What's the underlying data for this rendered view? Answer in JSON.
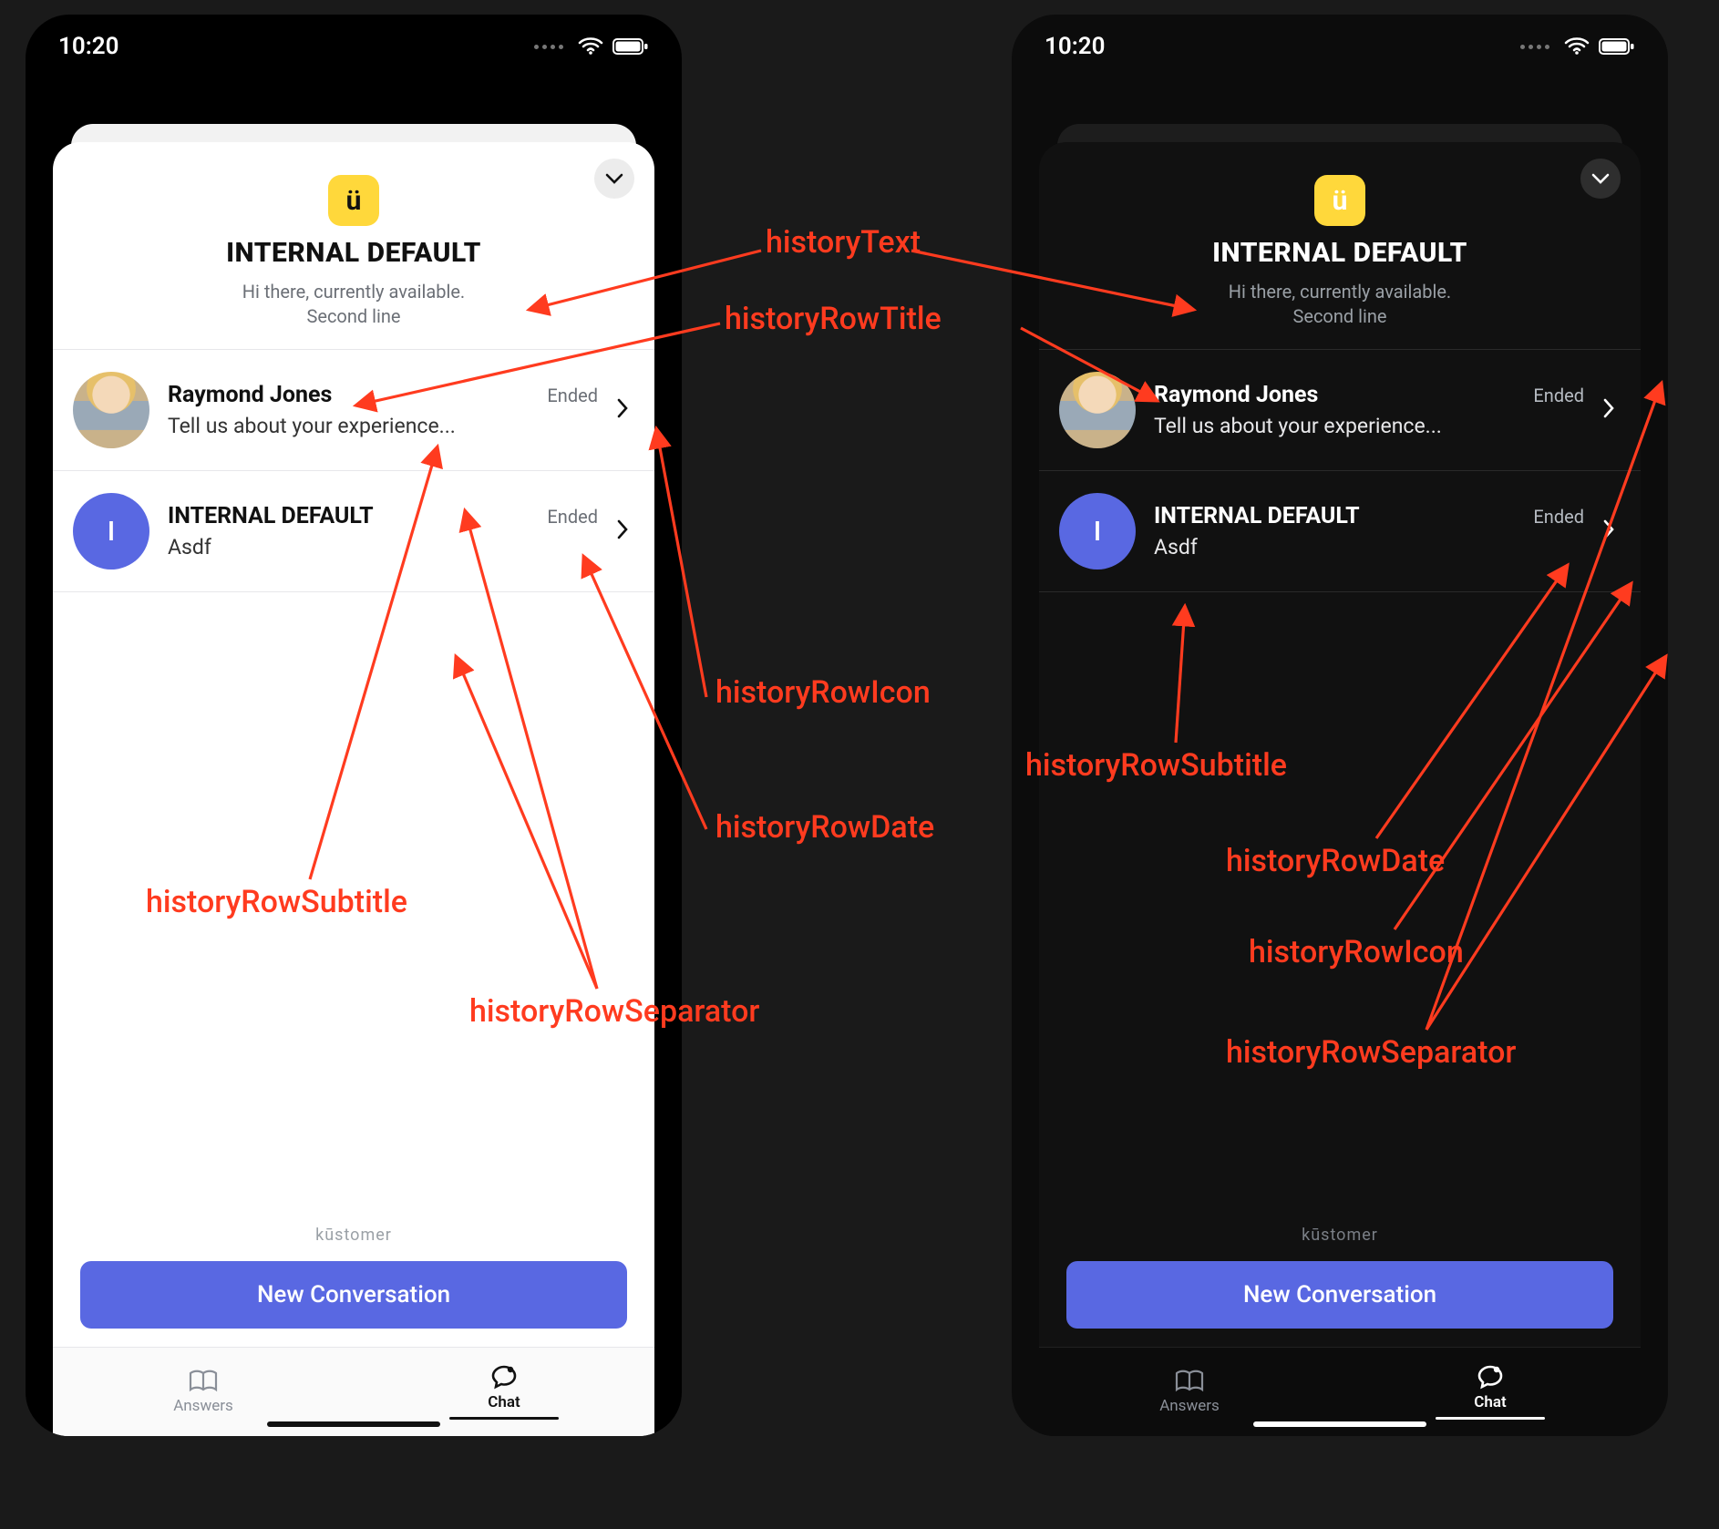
{
  "status": {
    "time": "10:20"
  },
  "header": {
    "title": "INTERNAL DEFAULT",
    "subtitle_line1": "Hi there, currently available.",
    "subtitle_line2": "Second line",
    "logo_glyph": "ü"
  },
  "rows": [
    {
      "avatar_kind": "photo",
      "avatar_initial": "",
      "title": "Raymond Jones",
      "subtitle": "Tell us about your experience...",
      "date": "Ended"
    },
    {
      "avatar_kind": "initial",
      "avatar_initial": "I",
      "title": "INTERNAL DEFAULT",
      "subtitle": "Asdf",
      "date": "Ended"
    }
  ],
  "footer": {
    "powered_by": "kūstomer",
    "cta": "New Conversation"
  },
  "tabs": {
    "answers": "Answers",
    "chat": "Chat"
  },
  "annotations": {
    "historyText": "historyText",
    "historyRowTitle": "historyRowTitle",
    "historyRowIcon": "historyRowIcon",
    "historyRowDate": "historyRowDate",
    "historyRowSubtitle": "historyRowSubtitle",
    "historyRowSeparator": "historyRowSeparator"
  }
}
